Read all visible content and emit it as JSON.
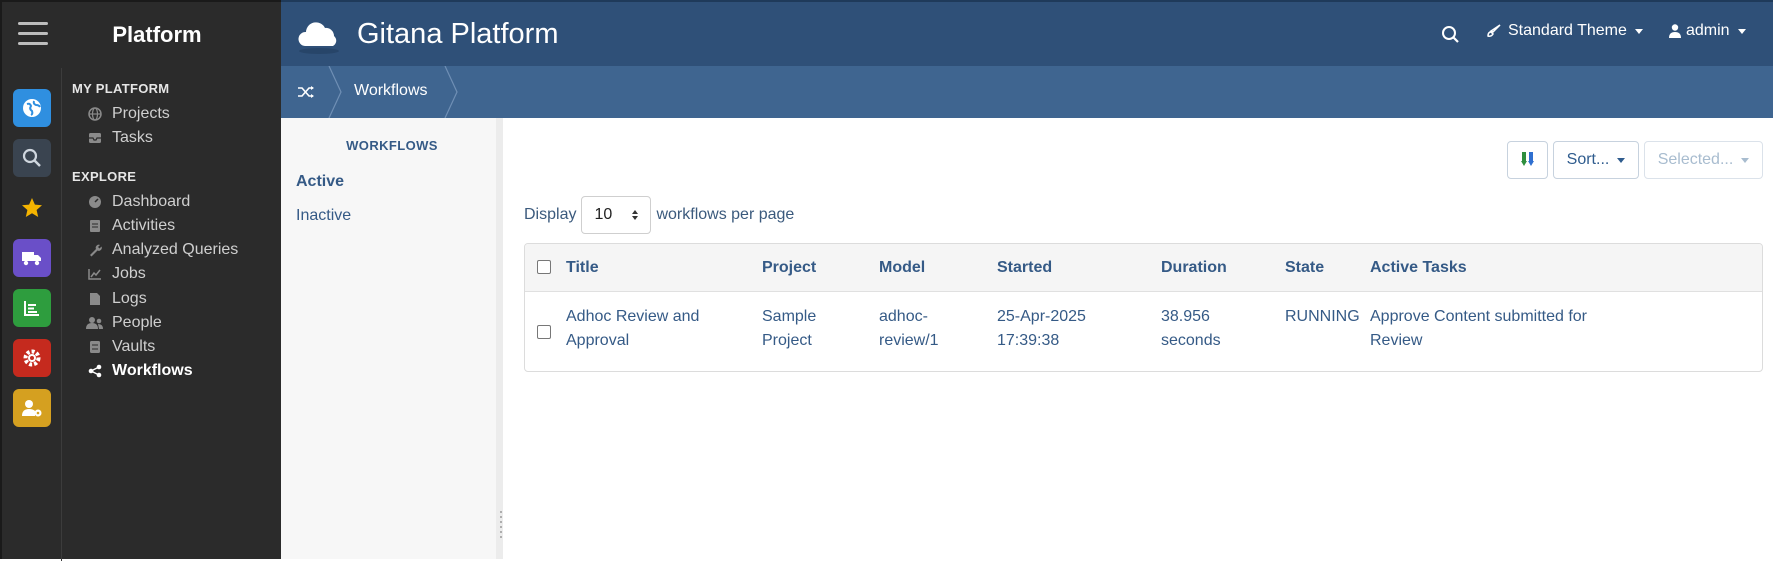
{
  "sidebar": {
    "brand": "Platform",
    "sections": [
      {
        "heading": "MY PLATFORM",
        "items": [
          {
            "label": "Projects",
            "icon": "globe-icon"
          },
          {
            "label": "Tasks",
            "icon": "inbox-icon"
          }
        ]
      },
      {
        "heading": "EXPLORE",
        "items": [
          {
            "label": "Dashboard",
            "icon": "gauge-icon"
          },
          {
            "label": "Activities",
            "icon": "activity-icon"
          },
          {
            "label": "Analyzed Queries",
            "icon": "wrench-icon"
          },
          {
            "label": "Jobs",
            "icon": "chart-icon"
          },
          {
            "label": "Logs",
            "icon": "file-icon"
          },
          {
            "label": "People",
            "icon": "people-icon"
          },
          {
            "label": "Vaults",
            "icon": "vault-icon"
          },
          {
            "label": "Workflows",
            "icon": "share-nodes-icon"
          }
        ]
      }
    ],
    "rail_colors": {
      "globe": "#2f8fe0",
      "search": "#3a4450",
      "star": "#f5b400",
      "truck": "#6a4fc8",
      "list": "#2e9d3e",
      "gear": "#c52a1e",
      "user_gear": "#d5a020"
    }
  },
  "header": {
    "title": "Gitana Platform",
    "theme_label": "Standard Theme",
    "user_label": "admin",
    "bg_color": "#2f5078"
  },
  "breadcrumb": {
    "label": "Workflows"
  },
  "subnav": {
    "title": "WORKFLOWS",
    "items": [
      "Active",
      "Inactive"
    ]
  },
  "toolbar": {
    "sort_label": "Sort...",
    "selected_label": "Selected..."
  },
  "display": {
    "prefix": "Display",
    "page_size": "10",
    "suffix": "workflows per page"
  },
  "table": {
    "columns": [
      "Title",
      "Project",
      "Model",
      "Started",
      "Duration",
      "State",
      "Active Tasks"
    ],
    "rows": [
      {
        "title": "Adhoc Review and Approval",
        "project": "Sample Project",
        "model": "adhoc-review/1",
        "started": "25-Apr-2025 17:39:38",
        "duration": "38.956 seconds",
        "state": "RUNNING",
        "active_tasks": "Approve Content submitted for Review"
      }
    ]
  }
}
